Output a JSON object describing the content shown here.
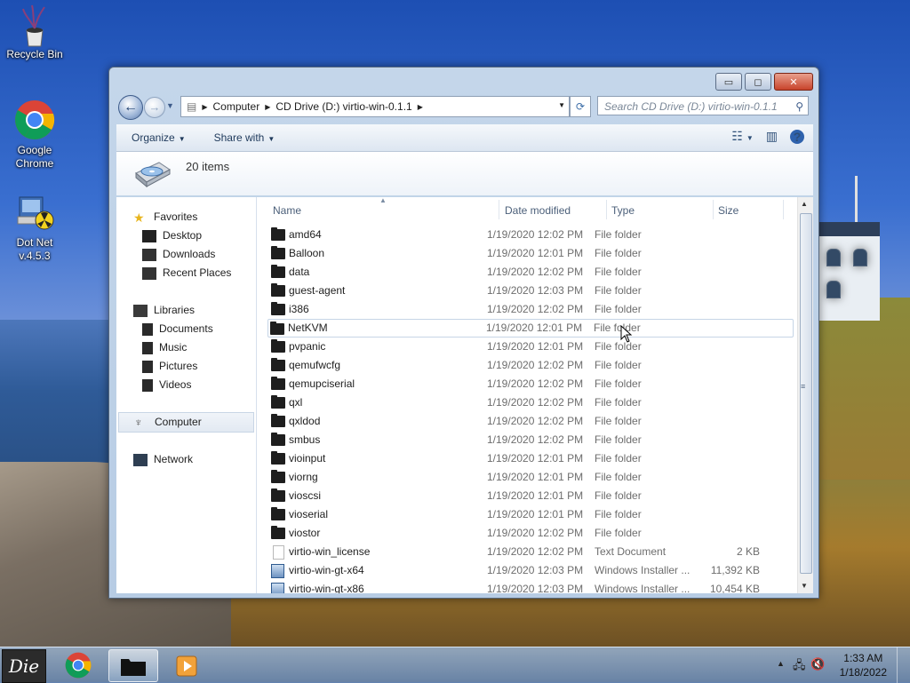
{
  "desktop": {
    "icons": [
      {
        "label": "Recycle Bin"
      },
      {
        "label": "Google Chrome"
      },
      {
        "label": "Dot Net v.4.5.3"
      }
    ]
  },
  "window": {
    "caption": {
      "minimize": "▭",
      "maximize": "◻",
      "close": "✕"
    },
    "address": {
      "segments": [
        "Computer",
        "CD Drive (D:) virtio-win-0.1.1"
      ]
    },
    "search": {
      "placeholder": "Search CD Drive (D:) virtio-win-0.1.1"
    },
    "toolbar": {
      "organize": "Organize",
      "share_with": "Share with"
    },
    "info": {
      "item_count": "20 items"
    },
    "navpane": {
      "favorites": {
        "label": "Favorites",
        "items": [
          "Desktop",
          "Downloads",
          "Recent Places"
        ]
      },
      "libraries": {
        "label": "Libraries",
        "items": [
          "Documents",
          "Music",
          "Pictures",
          "Videos"
        ]
      },
      "computer": {
        "label": "Computer"
      },
      "network": {
        "label": "Network"
      }
    },
    "columns": {
      "name": "Name",
      "date": "Date modified",
      "type": "Type",
      "size": "Size"
    },
    "files": [
      {
        "name": "amd64",
        "date": "1/19/2020 12:02 PM",
        "type": "File folder",
        "size": "",
        "kind": "folder"
      },
      {
        "name": "Balloon",
        "date": "1/19/2020 12:01 PM",
        "type": "File folder",
        "size": "",
        "kind": "folder"
      },
      {
        "name": "data",
        "date": "1/19/2020 12:02 PM",
        "type": "File folder",
        "size": "",
        "kind": "folder"
      },
      {
        "name": "guest-agent",
        "date": "1/19/2020 12:03 PM",
        "type": "File folder",
        "size": "",
        "kind": "folder"
      },
      {
        "name": "i386",
        "date": "1/19/2020 12:02 PM",
        "type": "File folder",
        "size": "",
        "kind": "folder"
      },
      {
        "name": "NetKVM",
        "date": "1/19/2020 12:01 PM",
        "type": "File folder",
        "size": "",
        "kind": "folder",
        "hover": true
      },
      {
        "name": "pvpanic",
        "date": "1/19/2020 12:01 PM",
        "type": "File folder",
        "size": "",
        "kind": "folder"
      },
      {
        "name": "qemufwcfg",
        "date": "1/19/2020 12:02 PM",
        "type": "File folder",
        "size": "",
        "kind": "folder"
      },
      {
        "name": "qemupciserial",
        "date": "1/19/2020 12:02 PM",
        "type": "File folder",
        "size": "",
        "kind": "folder"
      },
      {
        "name": "qxl",
        "date": "1/19/2020 12:02 PM",
        "type": "File folder",
        "size": "",
        "kind": "folder"
      },
      {
        "name": "qxldod",
        "date": "1/19/2020 12:02 PM",
        "type": "File folder",
        "size": "",
        "kind": "folder"
      },
      {
        "name": "smbus",
        "date": "1/19/2020 12:02 PM",
        "type": "File folder",
        "size": "",
        "kind": "folder"
      },
      {
        "name": "vioinput",
        "date": "1/19/2020 12:01 PM",
        "type": "File folder",
        "size": "",
        "kind": "folder"
      },
      {
        "name": "viorng",
        "date": "1/19/2020 12:01 PM",
        "type": "File folder",
        "size": "",
        "kind": "folder"
      },
      {
        "name": "vioscsi",
        "date": "1/19/2020 12:01 PM",
        "type": "File folder",
        "size": "",
        "kind": "folder"
      },
      {
        "name": "vioserial",
        "date": "1/19/2020 12:01 PM",
        "type": "File folder",
        "size": "",
        "kind": "folder"
      },
      {
        "name": "viostor",
        "date": "1/19/2020 12:02 PM",
        "type": "File folder",
        "size": "",
        "kind": "folder"
      },
      {
        "name": "virtio-win_license",
        "date": "1/19/2020 12:02 PM",
        "type": "Text Document",
        "size": "2 KB",
        "kind": "doc"
      },
      {
        "name": "virtio-win-gt-x64",
        "date": "1/19/2020 12:03 PM",
        "type": "Windows Installer ...",
        "size": "11,392 KB",
        "kind": "msi"
      },
      {
        "name": "virtio-win-gt-x86",
        "date": "1/19/2020 12:03 PM",
        "type": "Windows Installer ...",
        "size": "10,454 KB",
        "kind": "msi"
      }
    ]
  },
  "taskbar": {
    "start_label": "Die",
    "clock": {
      "time": "1:33 AM",
      "date": "1/18/2022"
    }
  }
}
